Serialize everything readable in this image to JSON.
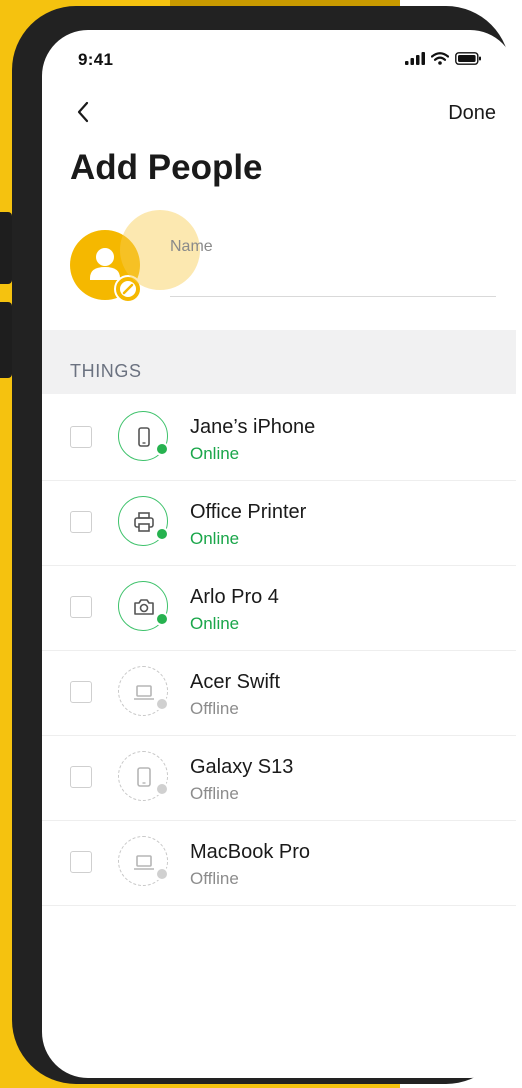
{
  "status_bar": {
    "time": "9:41"
  },
  "nav": {
    "back_icon": "chevron-left-icon",
    "done_label": "Done"
  },
  "page": {
    "title": "Add People"
  },
  "name_field": {
    "label": "Name",
    "value": ""
  },
  "section": {
    "title": "THINGS"
  },
  "devices": [
    {
      "name": "Jane’s iPhone",
      "status": "Online",
      "icon": "phone-icon"
    },
    {
      "name": "Office Printer",
      "status": "Online",
      "icon": "printer-icon"
    },
    {
      "name": "Arlo Pro 4",
      "status": "Online",
      "icon": "camera-icon"
    },
    {
      "name": "Acer Swift",
      "status": "Offline",
      "icon": "laptop-icon"
    },
    {
      "name": "Galaxy S13",
      "status": "Offline",
      "icon": "tablet-icon"
    },
    {
      "name": "MacBook Pro",
      "status": "Offline",
      "icon": "laptop-icon"
    }
  ],
  "colors": {
    "accent": "#f5b800",
    "online": "#1aa64a",
    "offline": "#8c8c8c",
    "frame": "#222222"
  }
}
